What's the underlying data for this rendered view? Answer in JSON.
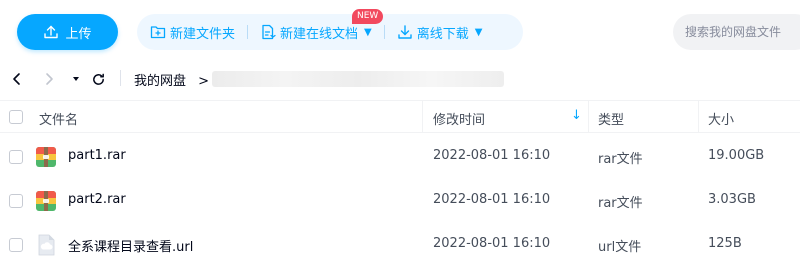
{
  "toolbar": {
    "upload_label": "上传",
    "new_folder_label": "新建文件夹",
    "new_online_doc_label": "新建在线文档",
    "offline_download_label": "离线下载",
    "new_badge": "NEW",
    "search_placeholder": "搜索我的网盘文件"
  },
  "nav": {
    "breadcrumb_root": "我的网盘",
    "breadcrumb_sep": ">"
  },
  "table": {
    "columns": {
      "name": "文件名",
      "modified": "修改时间",
      "type": "类型",
      "size": "大小"
    },
    "sort_indicator": "↓",
    "rows": [
      {
        "name": "part1.rar",
        "modified": "2022-08-01 16:10",
        "type": "rar文件",
        "size": "19.00GB",
        "icon": "rar-archive-icon"
      },
      {
        "name": "part2.rar",
        "modified": "2022-08-01 16:10",
        "type": "rar文件",
        "size": "3.03GB",
        "icon": "rar-archive-icon"
      },
      {
        "name": "全系课程目录查看.url",
        "modified": "2022-08-01 16:10",
        "type": "url文件",
        "size": "125B",
        "icon": "url-file-icon"
      }
    ]
  },
  "colors": {
    "accent": "#06a7ff",
    "badge": "#f2495e",
    "action_group_bg": "#eef7ff"
  }
}
